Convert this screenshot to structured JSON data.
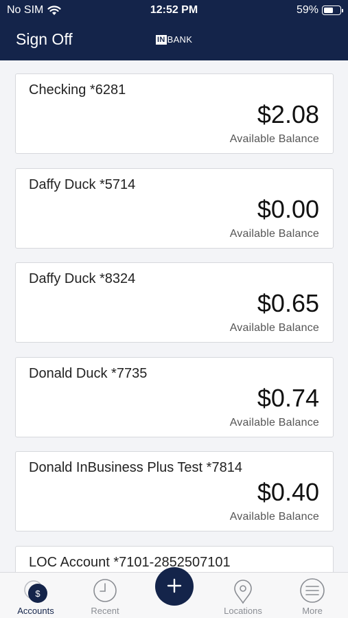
{
  "status_bar": {
    "carrier": "No SIM",
    "time": "12:52 PM",
    "battery_percent": "59%",
    "battery_level": 0.59
  },
  "header": {
    "sign_off_label": "Sign Off",
    "logo_mark": "IN",
    "logo_text": "BANK"
  },
  "accounts": [
    {
      "name": "Checking *6281",
      "amount": "$2.08",
      "label": "Available Balance"
    },
    {
      "name": "Daffy Duck *5714",
      "amount": "$0.00",
      "label": "Available Balance"
    },
    {
      "name": "Daffy Duck *8324",
      "amount": "$0.65",
      "label": "Available Balance"
    },
    {
      "name": "Donald Duck *7735",
      "amount": "$0.74",
      "label": "Available Balance"
    },
    {
      "name": "Donald InBusiness Plus Test *7814",
      "amount": "$0.40",
      "label": "Available Balance"
    },
    {
      "name": "LOC Account *7101-2852507101",
      "amount": "",
      "label": ""
    }
  ],
  "tabbar": {
    "tabs": [
      {
        "label": "Accounts",
        "icon": "dollar-circle-icon",
        "active": true
      },
      {
        "label": "Recent",
        "icon": "clock-icon",
        "active": false
      },
      {
        "label": "Locations",
        "icon": "map-pin-icon",
        "active": false
      },
      {
        "label": "More",
        "icon": "menu-icon",
        "active": false
      }
    ],
    "fab_icon": "plus-icon",
    "fab_symbol": "+"
  },
  "colors": {
    "brand_navy": "#14244a",
    "background": "#f3f4f7",
    "inactive_tab": "#8a8d93"
  }
}
